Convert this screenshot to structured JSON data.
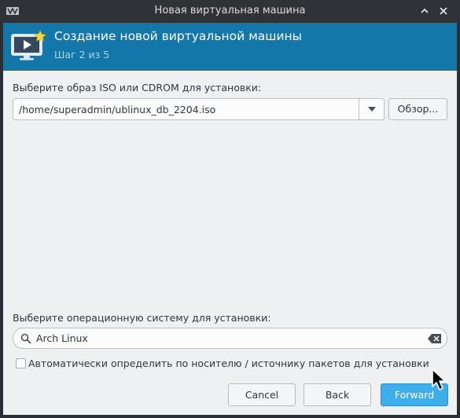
{
  "window": {
    "title": "Новая виртуальная машина",
    "icons": {
      "app": "virt-manager-icon",
      "minimize": "chevron-up-icon",
      "close": "close-icon"
    }
  },
  "header": {
    "title": "Создание новой виртуальной машины",
    "step": "Шаг 2 из 5",
    "icon": "monitor-play-star-icon"
  },
  "install_media": {
    "label": "Выберите образ ISO или CDROM для установки:",
    "path_value": "/home/superadmin/ublinux_db_2204.iso",
    "browse_label": "Обзор..."
  },
  "os_select": {
    "label": "Выберите операционную систему для установки:",
    "search_value": "Arch Linux",
    "auto_detect_label": "Автоматически определить по носителю / источнику пакетов для установки",
    "auto_detect_checked": false
  },
  "buttons": {
    "cancel": "Cancel",
    "back": "Back",
    "forward": "Forward"
  },
  "colors": {
    "banner": "#1377aa",
    "accent": "#3daee9",
    "window_bg": "#eff0f1",
    "titlebar": "#2f3237"
  }
}
